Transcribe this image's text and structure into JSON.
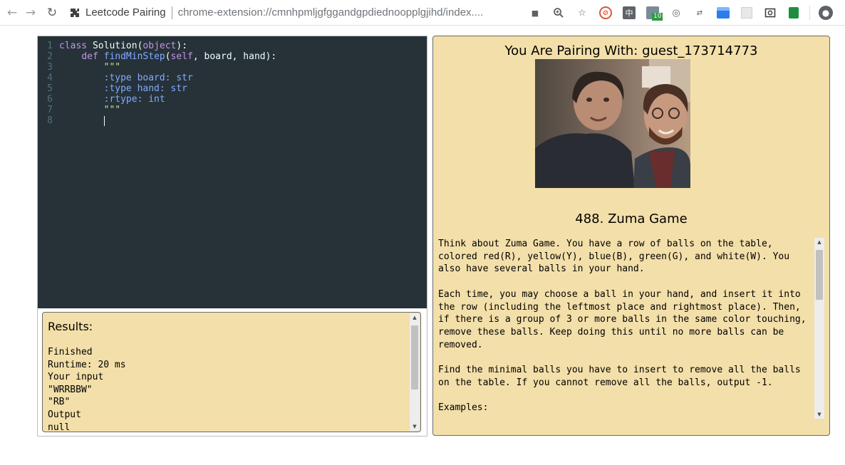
{
  "browser": {
    "tab_title": "Leetcode Pairing",
    "url": "chrome-extension://cmnhpmljgfggandgpdiednoopplgjihd/index....",
    "badge_count": "10"
  },
  "editor": {
    "lines": [
      {
        "n": "1",
        "tokens": [
          {
            "t": "class",
            "c": "kw"
          },
          {
            "t": " Solution(",
            "c": "code"
          },
          {
            "t": "object",
            "c": "kw"
          },
          {
            "t": "):",
            "c": "code"
          }
        ]
      },
      {
        "n": "2",
        "tokens": [
          {
            "t": "    ",
            "c": "code"
          },
          {
            "t": "def",
            "c": "kw"
          },
          {
            "t": " ",
            "c": "code"
          },
          {
            "t": "findMinStep",
            "c": "fn"
          },
          {
            "t": "(",
            "c": "code"
          },
          {
            "t": "self",
            "c": "kw"
          },
          {
            "t": ", board, hand):",
            "c": "code"
          }
        ]
      },
      {
        "n": "3",
        "tokens": [
          {
            "t": "        \"\"\"",
            "c": "str"
          }
        ]
      },
      {
        "n": "4",
        "tokens": [
          {
            "t": "        :type board: str",
            "c": "fn"
          }
        ]
      },
      {
        "n": "5",
        "tokens": [
          {
            "t": "        :type hand: str",
            "c": "fn"
          }
        ]
      },
      {
        "n": "6",
        "tokens": [
          {
            "t": "        :rtype: int",
            "c": "fn"
          }
        ]
      },
      {
        "n": "7",
        "tokens": [
          {
            "t": "        \"\"\"",
            "c": "str"
          }
        ]
      },
      {
        "n": "8",
        "tokens": [
          {
            "t": "        ",
            "c": "code"
          }
        ],
        "cursor": true
      }
    ]
  },
  "results": {
    "title": "Results:",
    "lines": [
      "Finished",
      "Runtime: 20 ms",
      "Your input",
      "\"WRRBBW\"",
      "\"RB\"",
      "Output",
      "null"
    ]
  },
  "pairing": {
    "title": "You Are Pairing With: guest_173714773"
  },
  "problem": {
    "title": "488. Zuma Game",
    "paragraphs": [
      "Think about Zuma Game. You have a row of balls on the table, colored red(R), yellow(Y), blue(B), green(G), and white(W). You also have several balls in your hand.",
      "Each time, you may choose a ball in your hand, and insert it into the row (including the leftmost place and rightmost place). Then, if there is a group of 3 or more balls in the same color touching, remove these balls. Keep doing this until no more balls can be removed.",
      "Find the minimal balls you have to insert to remove all the balls on the table. If you cannot remove all the balls, output -1.",
      "Examples:"
    ]
  }
}
